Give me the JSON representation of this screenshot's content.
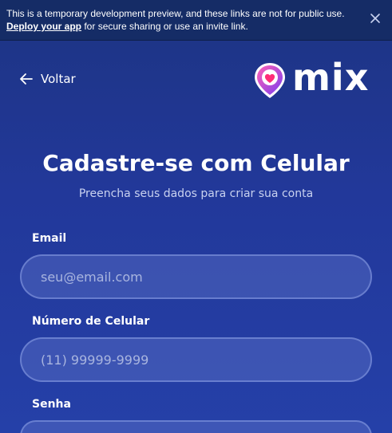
{
  "banner": {
    "text_line1": "This is a temporary development preview, and these links are not for public use.",
    "link_text": "Deploy your app",
    "text_line2_rest": " for secure sharing or use an invite link.",
    "close_icon": "close-icon"
  },
  "nav": {
    "back_label": "Voltar",
    "back_icon": "arrow-left-icon"
  },
  "logo": {
    "text": "mix",
    "icon": "location-pin-heart-icon",
    "colors": {
      "pin_pink": "#ff3fa3",
      "pin_purple": "#7b3df0",
      "heart": "#ff2d78"
    }
  },
  "header": {
    "title": "Cadastre-se com Celular",
    "subtitle": "Preencha seus dados para criar sua conta"
  },
  "form": {
    "email_label": "Email",
    "email_placeholder": "seu@email.com",
    "phone_label": "Número de Celular",
    "phone_placeholder": "(11) 99999-9999",
    "password_label": "Senha",
    "password_placeholder": ""
  },
  "colors": {
    "background": "#22389a",
    "banner": "#152c66",
    "input_fill": "#4a5fbf"
  }
}
